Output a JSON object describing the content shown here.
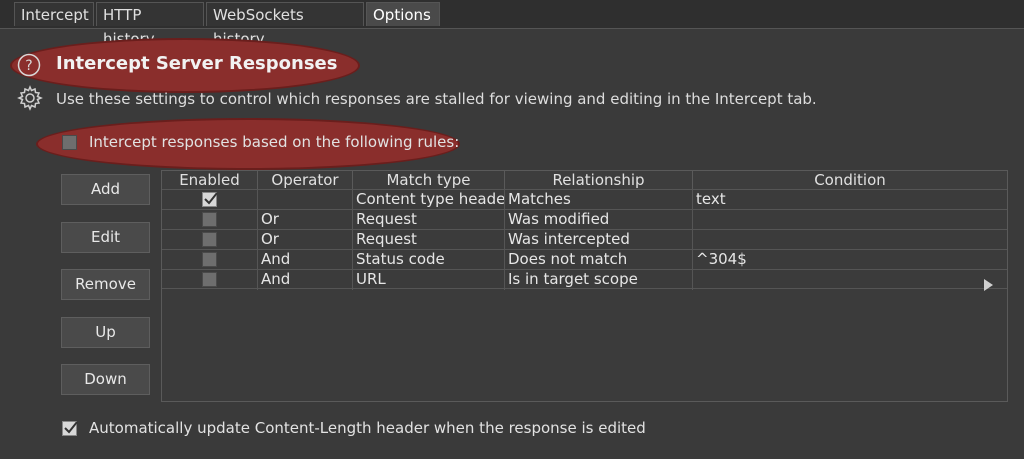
{
  "tabs": [
    {
      "label": "Intercept",
      "active": false
    },
    {
      "label": "HTTP history",
      "active": false
    },
    {
      "label": "WebSockets history",
      "active": false
    },
    {
      "label": "Options",
      "active": true
    }
  ],
  "section": {
    "title": "Intercept Server Responses",
    "description": "Use these settings to control which responses are stalled for viewing and editing in the Intercept tab.",
    "intercept_rule_checkbox": {
      "label": "Intercept responses based on the following rules:",
      "checked": false
    }
  },
  "buttons": {
    "add": "Add",
    "edit": "Edit",
    "remove": "Remove",
    "up": "Up",
    "down": "Down"
  },
  "table": {
    "columns": [
      "Enabled",
      "Operator",
      "Match type",
      "Relationship",
      "Condition"
    ],
    "rows": [
      {
        "enabled": true,
        "operator": "",
        "match_type": "Content type header",
        "relationship": "Matches",
        "condition": "text"
      },
      {
        "enabled": false,
        "operator": "Or",
        "match_type": "Request",
        "relationship": "Was modified",
        "condition": ""
      },
      {
        "enabled": false,
        "operator": "Or",
        "match_type": "Request",
        "relationship": "Was intercepted",
        "condition": ""
      },
      {
        "enabled": false,
        "operator": "And",
        "match_type": "Status code",
        "relationship": "Does not match",
        "condition": "^304$"
      },
      {
        "enabled": false,
        "operator": "And",
        "match_type": "URL",
        "relationship": "Is in target scope",
        "condition": ""
      }
    ]
  },
  "auto_update_checkbox": {
    "label": "Automatically update Content-Length header when the response is edited",
    "checked": true
  },
  "colors": {
    "background": "#3a3a3a",
    "highlight": "#8a2e2c"
  }
}
